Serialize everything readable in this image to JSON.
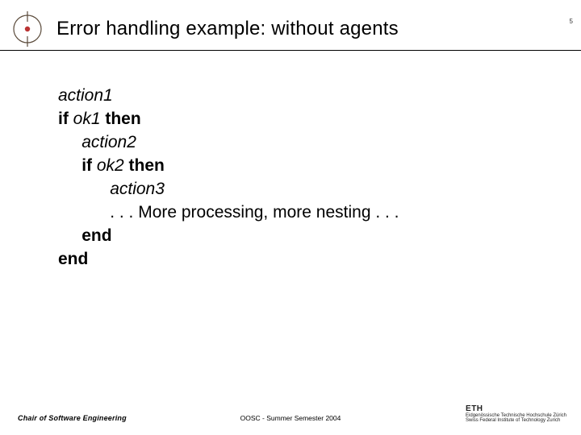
{
  "page_number": "5",
  "title": "Error handling example: without agents",
  "code": {
    "l1": "action1",
    "l2_if": "if ",
    "l2_cond": "ok1",
    "l2_then": " then",
    "l3": "action2",
    "l4_if": "if ",
    "l4_cond": "ok2",
    "l4_then": " then",
    "l5": "action3",
    "l6": ". . . More processing, more nesting . . .",
    "l7": "end",
    "l8": "end"
  },
  "footer": {
    "left": "Chair of Software Engineering",
    "center": "OOSC - Summer Semester 2004",
    "eth": "ETH",
    "eth_sub1": "Eidgenössische Technische Hochschule Zürich",
    "eth_sub2": "Swiss Federal Institute of Technology Zurich"
  }
}
